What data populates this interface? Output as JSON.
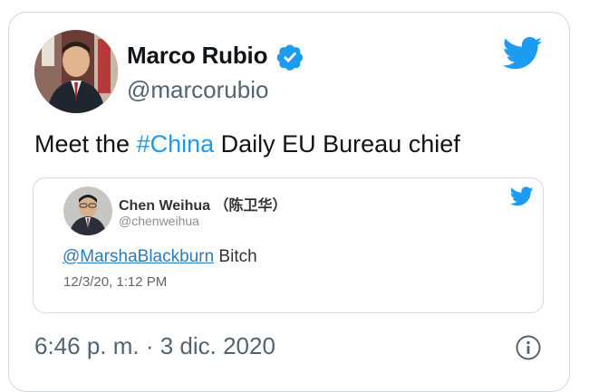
{
  "author": {
    "name": "Marco Rubio",
    "handle": "@marcorubio"
  },
  "tweet": {
    "text_before": "Meet the ",
    "hashtag": "#China",
    "text_after": " Daily EU Bureau chief",
    "timestamp": "6:46 p. m. · 3 dic. 2020"
  },
  "quoted": {
    "name": "Chen Weihua （陈卫华）",
    "handle": "@chenweihua",
    "mention": "@MarshaBlackburn",
    "text": " Bitch",
    "date": "12/3/20, 1:12 PM"
  },
  "colors": {
    "accent": "#1d9bf0",
    "verified": "#1d9bf0",
    "border": "#cfd9de"
  },
  "icons": {
    "brand": "twitter-bird-icon",
    "verified": "verified-badge-icon",
    "info": "info-icon"
  }
}
